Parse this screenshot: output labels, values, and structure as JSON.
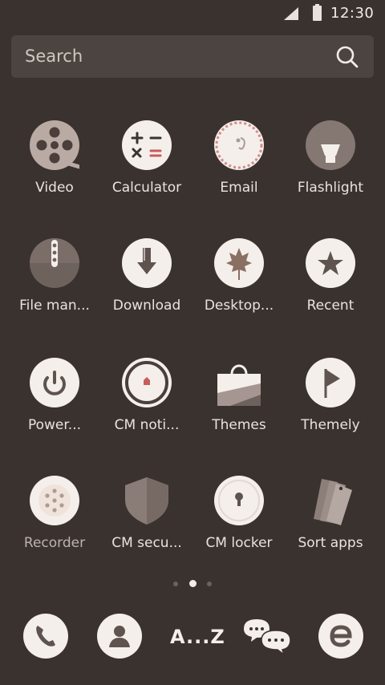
{
  "status": {
    "time": "12:30"
  },
  "search": {
    "label": "Search"
  },
  "apps": [
    {
      "label": "Video"
    },
    {
      "label": "Calculator"
    },
    {
      "label": "Email"
    },
    {
      "label": "Flashlight"
    },
    {
      "label": "File man..."
    },
    {
      "label": "Download"
    },
    {
      "label": "Desktop..."
    },
    {
      "label": "Recent"
    },
    {
      "label": "Power..."
    },
    {
      "label": "CM noti..."
    },
    {
      "label": "Themes"
    },
    {
      "label": "Themely"
    },
    {
      "label": "Recorder"
    },
    {
      "label": "CM secu..."
    },
    {
      "label": "CM locker"
    },
    {
      "label": "Sort apps"
    }
  ],
  "pager": {
    "pages": 3,
    "active": 2
  },
  "dock": {
    "az_label": "A...Z"
  },
  "colors": {
    "background": "#3a322e",
    "icon_light": "#f4efea",
    "icon_dark": "#6e625d",
    "accent_red": "#c65c5c"
  }
}
